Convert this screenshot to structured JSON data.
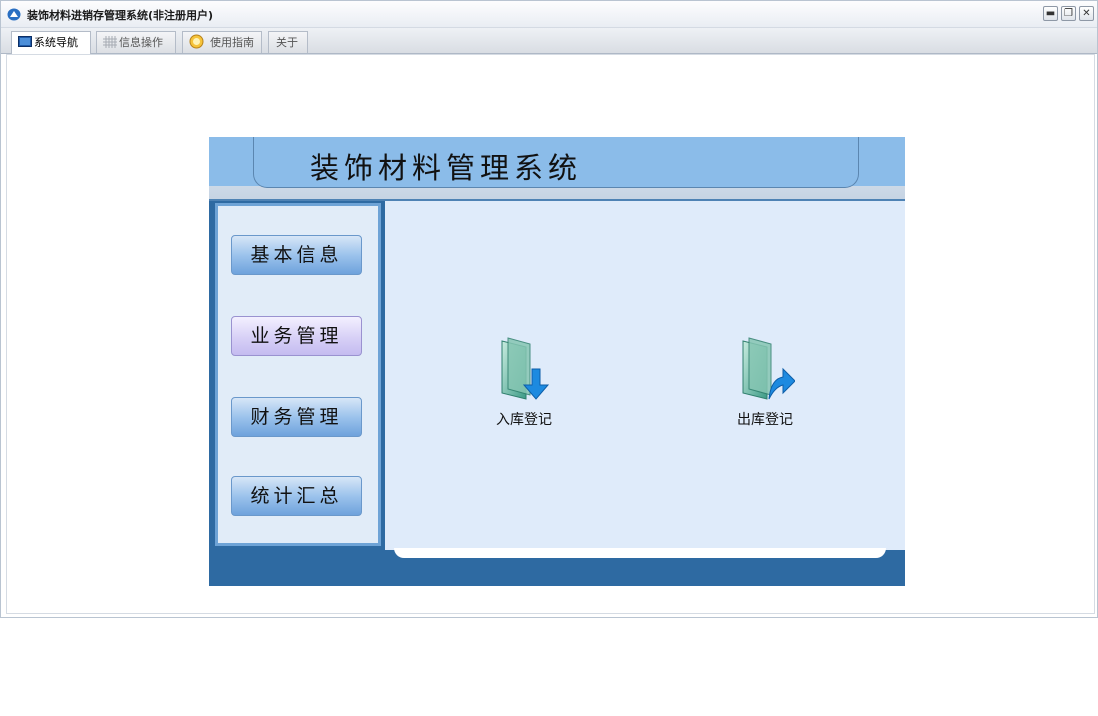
{
  "window": {
    "title": "装饰材料进销存管理系统(非注册用户)"
  },
  "tabs": [
    {
      "label": "系统导航",
      "active": true
    },
    {
      "label": "信息操作",
      "active": false
    },
    {
      "label": "使用指南",
      "active": false
    },
    {
      "label": "关于",
      "active": false
    }
  ],
  "system": {
    "title": "装饰材料管理系统",
    "menu": [
      {
        "label": "基本信息"
      },
      {
        "label": "业务管理",
        "selected": true
      },
      {
        "label": "财务管理"
      },
      {
        "label": "统计汇总"
      }
    ],
    "functions": [
      {
        "label": "入库登记",
        "icon": "inbound-folder-icon"
      },
      {
        "label": "出库登记",
        "icon": "outbound-folder-icon"
      }
    ]
  },
  "colors": {
    "header": "#8bbce9",
    "panel": "#2e6aa2",
    "main": "#dfebfa"
  }
}
